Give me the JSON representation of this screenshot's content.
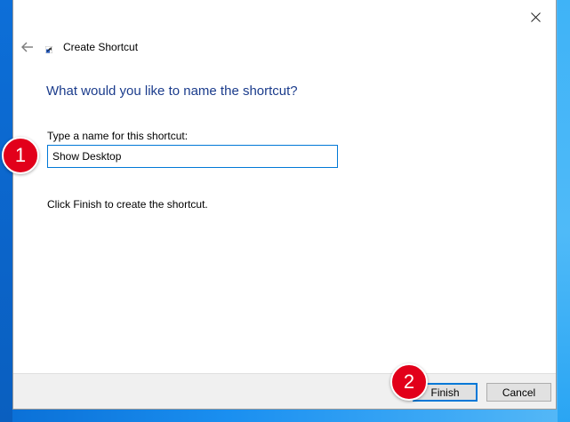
{
  "window": {
    "title": "Create Shortcut",
    "heading": "What would you like to name the shortcut?",
    "field_label": "Type a name for this shortcut:",
    "name_value": "Show Desktop",
    "hint": "Click Finish to create the shortcut."
  },
  "footer": {
    "finish_label": "Finish",
    "cancel_label": "Cancel"
  },
  "markers": {
    "step1": "1",
    "step2": "2"
  },
  "icons": {
    "close": "close-icon",
    "back": "back-arrow-icon",
    "shortcut": "shortcut-icon"
  },
  "colors": {
    "heading": "#1b3c8c",
    "marker": "#e2001a",
    "focus": "#0078d7"
  }
}
